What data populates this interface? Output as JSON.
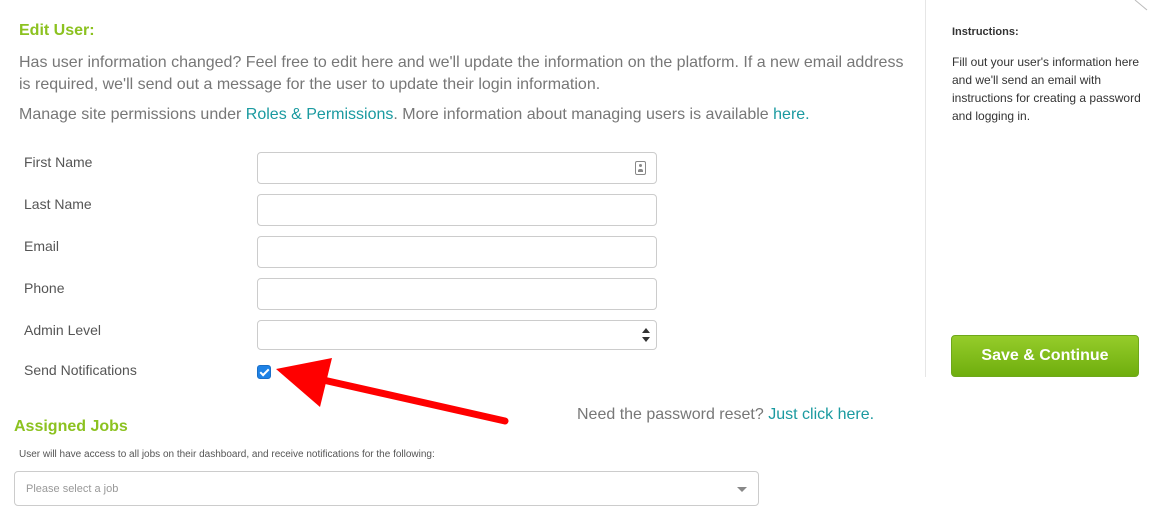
{
  "colors": {
    "accent_green": "#8cc220",
    "link_teal": "#1a9aa0",
    "button_green_top": "#95cc2a",
    "button_green_bottom": "#6fae0e",
    "checkbox_blue": "#1e82e6",
    "arrow_red": "#ff0000"
  },
  "edit": {
    "title": "Edit User:",
    "intro": "Has user information changed? Feel free to edit here and we'll update the information on the platform. If a new email address is required, we'll send out a message for the user to update their login information.",
    "perm_prefix": "Manage site permissions under ",
    "perm_link": "Roles & Permissions",
    "perm_middle": ". More information about managing users is available ",
    "perm_here": "here."
  },
  "form": {
    "first_name_label": "First Name",
    "first_name_value": "",
    "last_name_label": "Last Name",
    "last_name_value": "",
    "email_label": "Email",
    "email_value": "",
    "phone_label": "Phone",
    "phone_value": "",
    "admin_level_label": "Admin Level",
    "admin_level_value": "",
    "send_notifications_label": "Send Notifications",
    "send_notifications_checked": true
  },
  "reset": {
    "text": "Need the password reset? ",
    "link": "Just click here."
  },
  "assigned": {
    "title": "Assigned Jobs",
    "description": "User will have access to all jobs on their dashboard, and receive notifications for the following:",
    "placeholder": "Please select a job"
  },
  "sidebar": {
    "instructions_title": "Instructions:",
    "instructions_text": "Fill out your user's information here and we'll send an email with instructions for creating a password and logging in.",
    "save_label": "Save & Continue"
  }
}
